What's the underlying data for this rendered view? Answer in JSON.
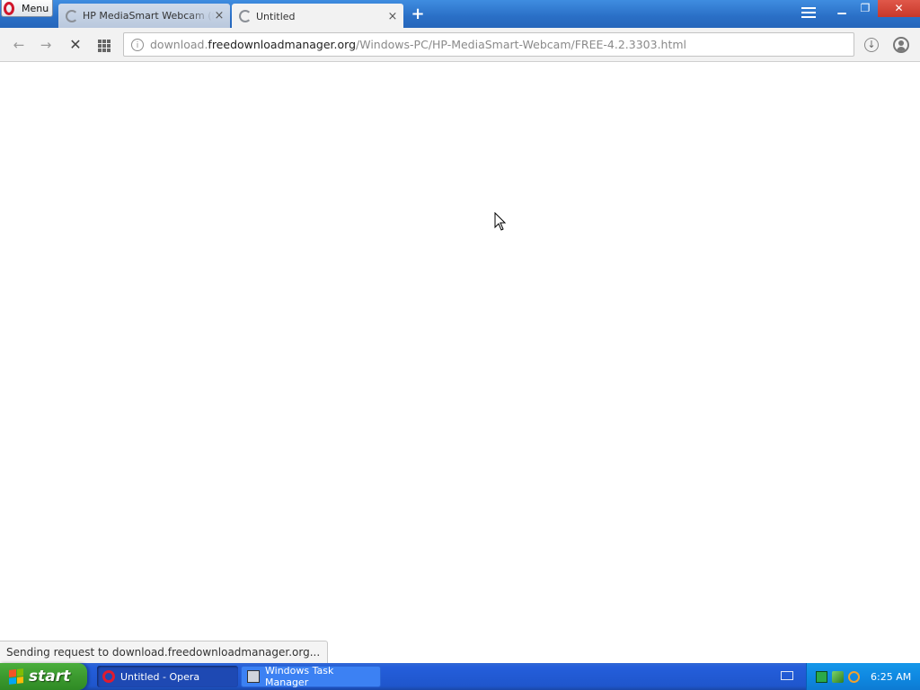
{
  "browser": {
    "menu_label": "Menu",
    "tabs": [
      {
        "title": "HP MediaSmart Webcam (fre",
        "close": "×"
      },
      {
        "title": "Untitled",
        "close": "×"
      }
    ],
    "new_tab_symbol": "+",
    "window_controls": {
      "minimize": "▁",
      "maximize": "❐",
      "close": "✕"
    },
    "nav": {
      "back": "←",
      "forward": "→",
      "stop": "✕"
    },
    "address": {
      "prefix": "download.",
      "host": "freedownloadmanager.org",
      "path": "/Windows-PC/HP-MediaSmart-Webcam/FREE-4.2.3303.html"
    },
    "status_text": "Sending request to download.freedownloadmanager.org..."
  },
  "taskbar": {
    "start_label": "start",
    "tasks": [
      {
        "label": "Untitled - Opera",
        "icon": "opera-icon"
      },
      {
        "label": "Windows Task Manager",
        "icon": "task-manager-icon"
      }
    ],
    "clock": "6:25 AM"
  },
  "colors": {
    "accent": "#2a6fc6",
    "taskbar": "#245edb",
    "start_green": "#3c9a2f",
    "opera_red": "#d1162b"
  }
}
